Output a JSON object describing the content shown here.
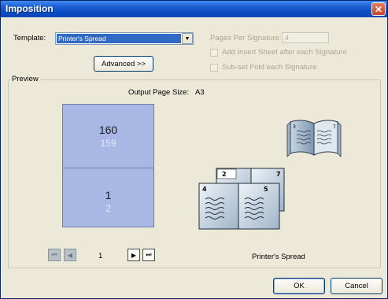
{
  "window": {
    "title": "Imposition",
    "close_glyph": "✕"
  },
  "template": {
    "label": "Template:",
    "value": "Printer's Spread",
    "arrow": "▼"
  },
  "advanced_button": "Advanced >>",
  "pages_per_signature": {
    "label": "Pages Per Signature:",
    "value": "4"
  },
  "options": {
    "add_insert_sheet": "Add Insert Sheet after each Signature",
    "subset_fold": "Sub-set Fold each Signature"
  },
  "preview": {
    "legend": "Preview",
    "output_label": "Output Page Size:",
    "output_value": "A3",
    "sheet": {
      "top_front": "160",
      "top_back": "159",
      "bottom_front": "1",
      "bottom_back": "2"
    },
    "signature_pages": [
      "2",
      "7",
      "4",
      "5",
      "3"
    ],
    "caption": "Printer's Spread"
  },
  "navigation": {
    "first_glyph": "⏮",
    "prev_glyph": "◀",
    "next_glyph": "▶",
    "last_glyph": "⏭",
    "current_page": "1"
  },
  "buttons": {
    "ok": "OK",
    "cancel": "Cancel"
  },
  "colors": {
    "titlebar": "#0a4bc4",
    "dialog_bg": "#ece9d8",
    "sheet_fill": "#a9b7e4",
    "selection": "#316ac5",
    "close_button": "#c84427"
  }
}
